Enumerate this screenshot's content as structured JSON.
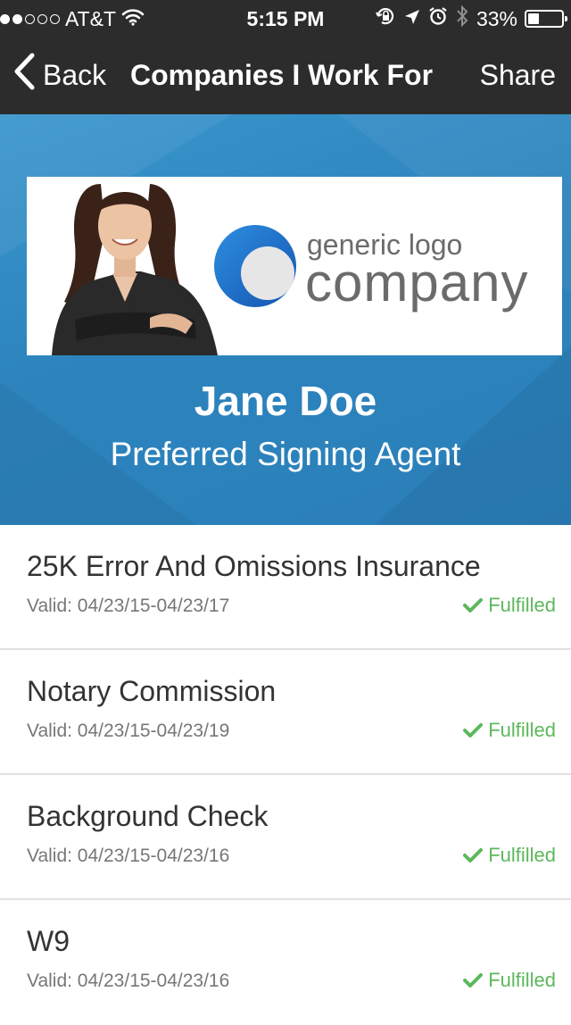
{
  "status_bar": {
    "carrier": "AT&T",
    "signal_bars_filled": 2,
    "signal_bars_total": 5,
    "time": "5:15 PM",
    "battery_percent_label": "33%",
    "battery_level": 0.33,
    "icons": [
      "wifi-icon",
      "rotation-lock-icon",
      "location-arrow-icon",
      "alarm-icon",
      "bluetooth-icon",
      "battery-icon"
    ]
  },
  "nav": {
    "back_label": "Back",
    "title": "Companies I Work For",
    "share_label": "Share"
  },
  "profile": {
    "logo_line1": "generic logo",
    "logo_line2": "company",
    "name": "Jane Doe",
    "role": "Preferred Signing Agent"
  },
  "requirements": [
    {
      "title": "25K Error And Omissions Insurance",
      "valid": "Valid: 04/23/15-04/23/17",
      "status": "Fulfilled"
    },
    {
      "title": "Notary Commission",
      "valid": "Valid: 04/23/15-04/23/19",
      "status": "Fulfilled"
    },
    {
      "title": "Background Check",
      "valid": "Valid: 04/23/15-04/23/16",
      "status": "Fulfilled"
    },
    {
      "title": "W9",
      "valid": "Valid: 04/23/15-04/23/16",
      "status": "Fulfilled"
    }
  ],
  "colors": {
    "nav_background": "#2c2c2c",
    "hero_blue": "#2d84bd",
    "logo_blue": "#1f6fc6",
    "fulfilled_green": "#5cb85c",
    "divider": "#e2e2e2"
  }
}
